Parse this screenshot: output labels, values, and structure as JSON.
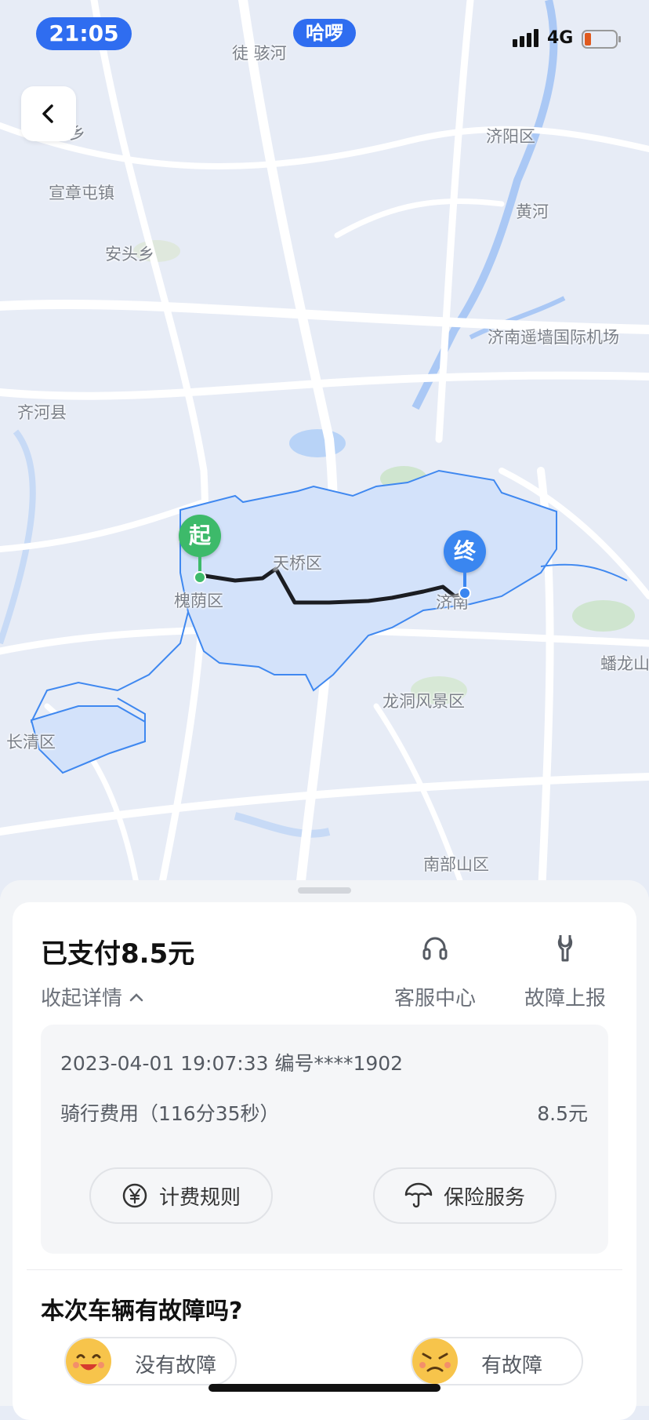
{
  "status_bar": {
    "time": "21:05",
    "app_badge": "哈啰",
    "network": "4G"
  },
  "map": {
    "labels": {
      "tuhaihe": "徒 骇河",
      "xiang": "乡",
      "jiyang": "济阳区",
      "xuanzhang": "宣章屯镇",
      "huanghe": "黄河",
      "antou": "安头乡",
      "airport": "济南遥墙国际机场",
      "qihe": "齐河县",
      "tianqiao": "天桥区",
      "huaiyin": "槐荫区",
      "jinan": "济南",
      "panlong": "蟠龙山",
      "longdong": "龙洞风景区",
      "changqing": "长清区",
      "nanbushan": "南部山区"
    },
    "start_marker": "起",
    "end_marker": "终"
  },
  "trip": {
    "paid_title": "已支付8.5元",
    "collapse_label": "收起详情",
    "order_line": "2023-04-01 19:07:33 编号****1902",
    "fee_label": "骑行费用（116分35秒）",
    "fee_amount": "8.5元"
  },
  "actions": {
    "service_label": "客服中心",
    "report_label": "故障上报"
  },
  "buttons": {
    "pricing_rules": "计费规则",
    "insurance": "保险服务"
  },
  "fault": {
    "question": "本次车辆有故障吗?",
    "no_fault": "没有故障",
    "has_fault": "有故障"
  },
  "colors": {
    "accent": "#2f6df0",
    "start_green": "#3dba6a",
    "end_blue": "#3a86f0",
    "zone_fill": "#d3e2fa",
    "zone_stroke": "#3f88f0"
  }
}
